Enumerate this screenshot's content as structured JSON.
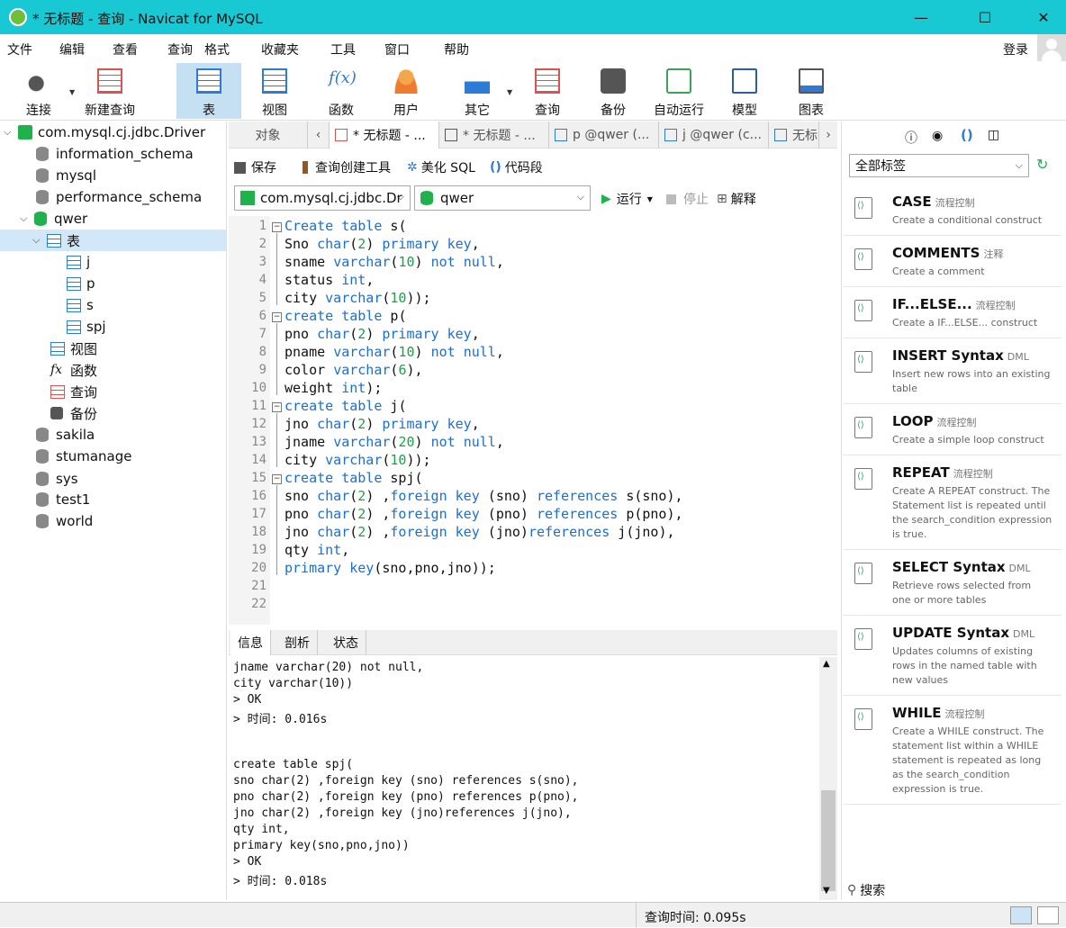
{
  "window": {
    "title": "* 无标题 - 查询 - Navicat for MySQL",
    "min": "—",
    "max": "☐",
    "close": "✕"
  },
  "menu": [
    "文件",
    "编辑",
    "查看",
    "查询",
    "格式",
    "收藏夹",
    "工具",
    "窗口",
    "帮助"
  ],
  "login_label": "登录",
  "toolbar": [
    "连接",
    "新建查询",
    "表",
    "视图",
    "函数",
    "用户",
    "其它",
    "查询",
    "备份",
    "自动运行",
    "模型",
    "图表"
  ],
  "tree": {
    "connection": "com.mysql.cj.jdbc.Driver",
    "dbs_top": [
      "information_schema",
      "mysql",
      "performance_schema"
    ],
    "open_db": "qwer",
    "tables_node": "表",
    "tables": [
      "j",
      "p",
      "s",
      "spj"
    ],
    "others": [
      "视图",
      "函数",
      "查询",
      "备份"
    ],
    "dbs_bottom": [
      "sakila",
      "stumanage",
      "sys",
      "test1",
      "world"
    ]
  },
  "tabs": {
    "objects": "对象",
    "items": [
      "* 无标题 - ...",
      "* 无标题 - ...",
      "p @qwer (...",
      "j @qwer (c...",
      "无标"
    ]
  },
  "subtool": {
    "save": "保存",
    "builder": "查询创建工具",
    "beautify": "美化 SQL",
    "snippet": "代码段"
  },
  "selectors": {
    "connection": "com.mysql.cj.jdbc.Dr",
    "database": "qwer",
    "run": "运行",
    "stop": "停止",
    "explain": "解释"
  },
  "code": [
    "Create table s(",
    "Sno char(2) primary key,",
    "sname varchar(10) not null,",
    "status int,",
    "city varchar(10));",
    "create table p(",
    "pno char(2) primary key,",
    "pname varchar(10) not null,",
    "color varchar(6),",
    "weight int);",
    "create table j(",
    "jno char(2) primary key,",
    "jname varchar(20) not null,",
    "city varchar(10));",
    "create table spj(",
    "sno char(2) ,foreign key (sno) references s(sno),",
    "pno char(2) ,foreign key (pno) references p(pno),",
    "jno char(2) ,foreign key (jno)references j(jno),",
    "qty int,",
    "primary key(sno,pno,jno));",
    "",
    ""
  ],
  "output_tabs": [
    "信息",
    "剖析",
    "状态"
  ],
  "output": [
    "jname varchar(20) not null,",
    "city varchar(10))",
    "> OK",
    "> 时间: 0.016s",
    "",
    "",
    "create table spj(",
    "sno char(2) ,foreign key (sno) references s(sno),",
    "pno char(2) ,foreign key (pno) references p(pno),",
    "jno char(2) ,foreign key (jno)references j(jno),",
    "qty int,",
    "primary key(sno,pno,jno))",
    "> OK",
    "> 时间: 0.018s"
  ],
  "right": {
    "tag_select": "全部标签",
    "search": "搜索",
    "snippets": [
      {
        "name": "CASE",
        "tag": "流程控制",
        "desc": "Create a conditional construct"
      },
      {
        "name": "COMMENTS",
        "tag": "注释",
        "desc": "Create a comment"
      },
      {
        "name": "IF...ELSE...",
        "tag": "流程控制",
        "desc": "Create a IF...ELSE... construct"
      },
      {
        "name": "INSERT Syntax",
        "tag": "DML",
        "desc": "Insert new rows into an existing table"
      },
      {
        "name": "LOOP",
        "tag": "流程控制",
        "desc": "Create a simple loop construct"
      },
      {
        "name": "REPEAT",
        "tag": "流程控制",
        "desc": "Create A REPEAT construct. The Statement list is repeated until the search_condition expression is true."
      },
      {
        "name": "SELECT Syntax",
        "tag": "DML",
        "desc": "Retrieve rows selected from one or more tables"
      },
      {
        "name": "UPDATE Syntax",
        "tag": "DML",
        "desc": "Updates columns of existing rows in the named table with new values"
      },
      {
        "name": "WHILE",
        "tag": "流程控制",
        "desc": "Create a WHILE construct. The statement list within a WHILE statement is repeated as long as the search_condition expression is true."
      }
    ]
  },
  "status": {
    "query_time": "查询时间: 0.095s"
  }
}
